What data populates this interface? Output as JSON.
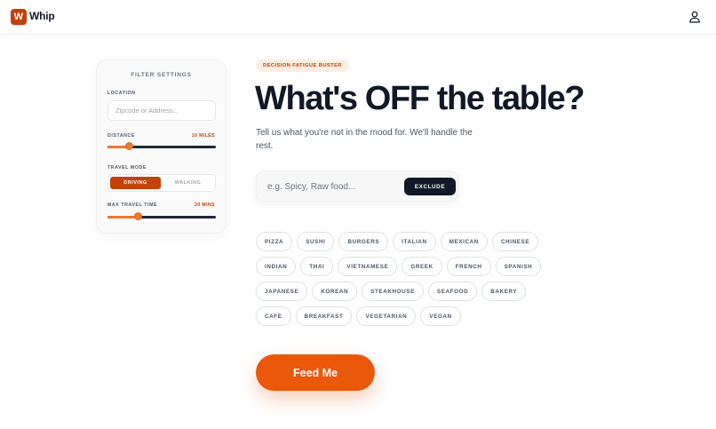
{
  "app": {
    "logo_letter": "W",
    "name": "Whip"
  },
  "filters": {
    "title": "FILTER SETTINGS",
    "location": {
      "label": "LOCATION",
      "placeholder": "Zipcode or Address...",
      "value": ""
    },
    "distance": {
      "label": "DISTANCE",
      "value_text": "10 MILES",
      "fraction": 0.2
    },
    "travel_mode": {
      "label": "TRAVEL MODE",
      "options": [
        "DRIVING",
        "WALKING"
      ],
      "selected": "DRIVING"
    },
    "max_travel_time": {
      "label": "MAX TRAVEL TIME",
      "value_text": "20 MINS",
      "fraction": 0.28
    }
  },
  "main": {
    "tagline": "DECISION FATIGUE BUSTER",
    "headline": "What's OFF the table?",
    "subtitle": "Tell us what you're not in the mood for. We'll handle the rest.",
    "exclude": {
      "placeholder": "e.g. Spicy, Raw food...",
      "value": "",
      "button": "EXCLUDE"
    },
    "cuisines": [
      [
        "PIZZA",
        "SUSHI",
        "BURGERS",
        "ITALIAN",
        "MEXICAN",
        "CHINESE"
      ],
      [
        "INDIAN",
        "THAI",
        "VIETNAMESE",
        "GREEK",
        "FRENCH",
        "SPANISH"
      ],
      [
        "JAPANESE",
        "KOREAN",
        "STEAKHOUSE",
        "SEAFOOD",
        "BAKERY"
      ],
      [
        "CAFE",
        "BREAKFAST",
        "VEGETARIAN",
        "VEGAN"
      ]
    ],
    "cta": "Feed Me"
  },
  "icons": {
    "header_right": "user-icon"
  },
  "colors": {
    "accent": "#ea580c",
    "accent_dark": "#c2410c",
    "dark": "#111827"
  }
}
